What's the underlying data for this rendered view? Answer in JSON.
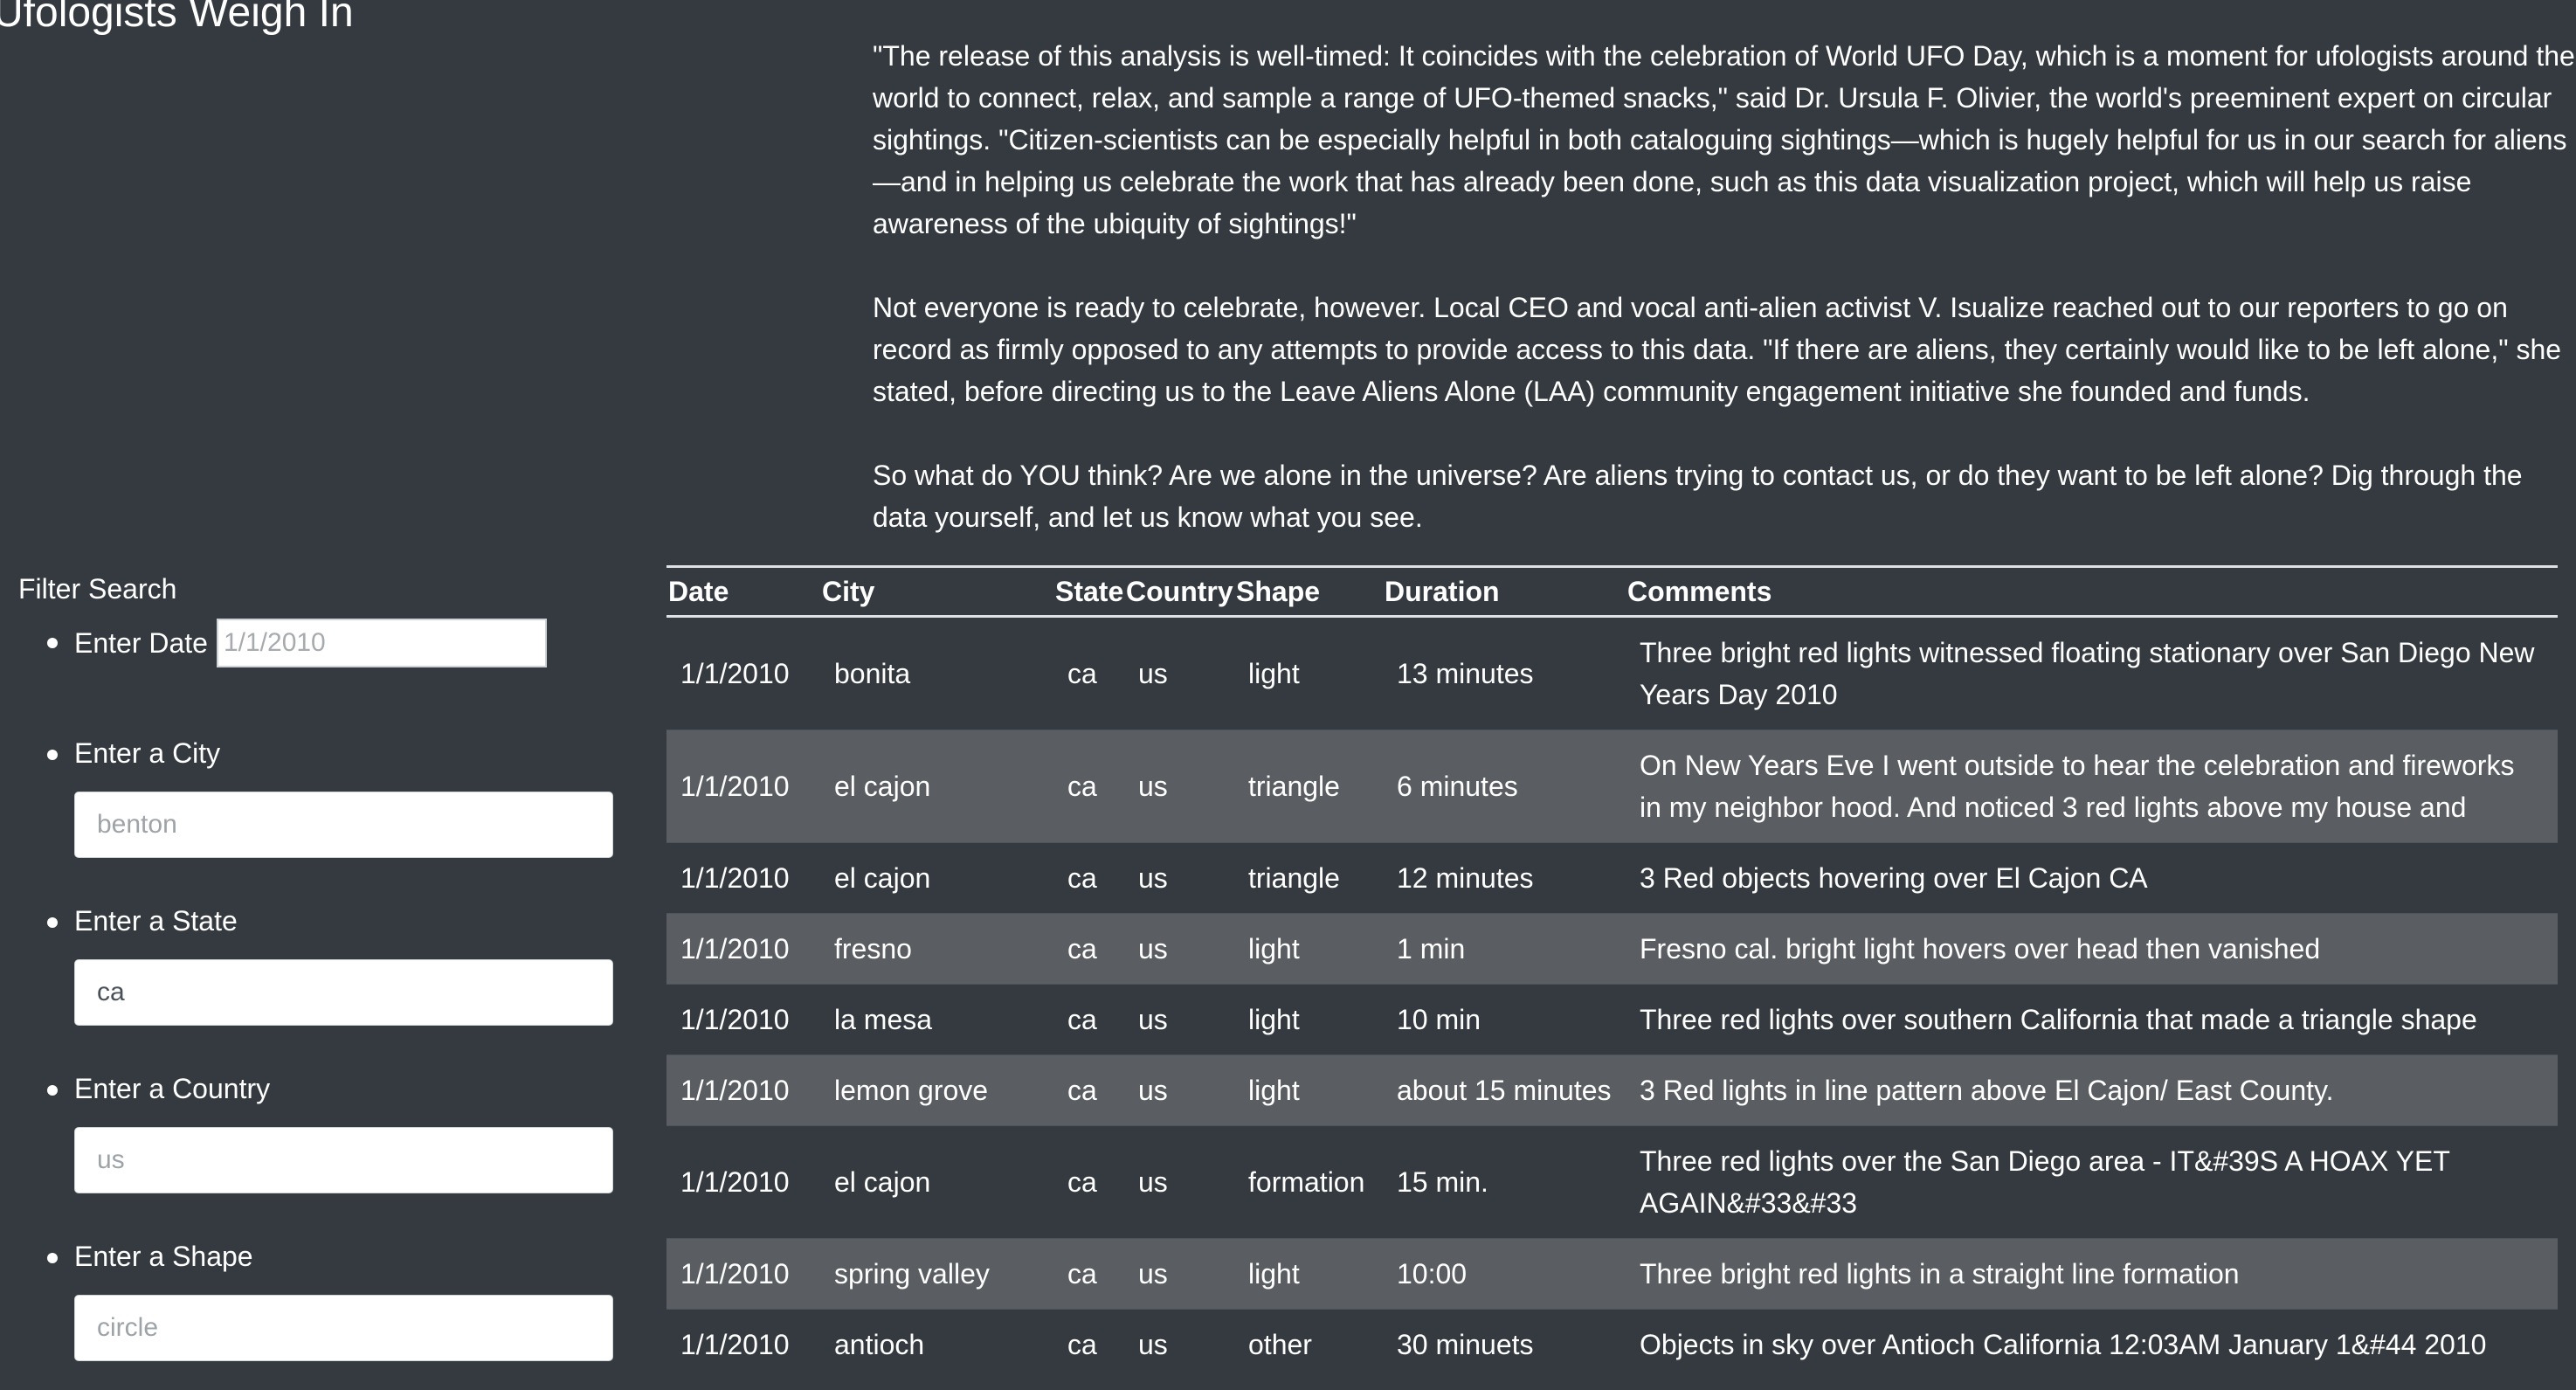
{
  "section_title": "Ufologists Weigh In",
  "article": {
    "paragraphs": [
      "\"The release of this analysis is well-timed: It coincides with the celebration of World UFO Day, which is a moment for ufologists around the world to connect, relax, and sample a range of UFO-themed snacks,\" said Dr. Ursula F. Olivier, the world's preeminent expert on circular sightings. \"Citizen-scientists can be especially helpful in both cataloguing sightings—which is hugely helpful for us in our search for aliens—and in helping us celebrate the work that has already been done, such as this data visualization project, which will help us raise awareness of the ubiquity of sightings!\"",
      "Not everyone is ready to celebrate, however. Local CEO and vocal anti-alien activist V. Isualize reached out to our reporters to go on record as firmly opposed to any attempts to provide access to this data. \"If there are aliens, they certainly would like to be left alone,\" she stated, before directing us to the Leave Aliens Alone (LAA) community engagement initiative she founded and funds.",
      "So what do YOU think? Are we alone in the universe? Are aliens trying to contact us, or do they want to be left alone? Dig through the data yourself, and let us know what you see."
    ]
  },
  "filters": {
    "title": "Filter Search",
    "date": {
      "label": "Enter Date",
      "placeholder": "1/1/2010",
      "value": ""
    },
    "city": {
      "label": "Enter a City",
      "placeholder": "benton",
      "value": ""
    },
    "state": {
      "label": "Enter a State",
      "placeholder": "ca",
      "value": "ca"
    },
    "country": {
      "label": "Enter a Country",
      "placeholder": "us",
      "value": ""
    },
    "shape": {
      "label": "Enter a Shape",
      "placeholder": "circle",
      "value": ""
    }
  },
  "table": {
    "headers": [
      "Date",
      "City",
      "State",
      "Country",
      "Shape",
      "Duration",
      "Comments"
    ],
    "rows": [
      [
        "1/1/2010",
        "bonita",
        "ca",
        "us",
        "light",
        "13 minutes",
        "Three bright red lights witnessed floating stationary over San Diego New Years Day 2010"
      ],
      [
        "1/1/2010",
        "el cajon",
        "ca",
        "us",
        "triangle",
        "6 minutes",
        "On New Years Eve I went outside to hear the celebration and fireworks in my neighbor hood. And noticed 3 red lights above my house and"
      ],
      [
        "1/1/2010",
        "el cajon",
        "ca",
        "us",
        "triangle",
        "12 minutes",
        "3 Red objects hovering over El Cajon CA"
      ],
      [
        "1/1/2010",
        "fresno",
        "ca",
        "us",
        "light",
        "1 min",
        "Fresno cal. bright light hovers over head then vanished"
      ],
      [
        "1/1/2010",
        "la mesa",
        "ca",
        "us",
        "light",
        "10 min",
        "Three red lights over southern California that made a triangle shape"
      ],
      [
        "1/1/2010",
        "lemon grove",
        "ca",
        "us",
        "light",
        "about 15 minutes",
        "3 Red lights in line pattern above El Cajon/ East County."
      ],
      [
        "1/1/2010",
        "el cajon",
        "ca",
        "us",
        "formation",
        "15 min.",
        "Three red lights over the San Diego area - IT&#39S A HOAX YET AGAIN&#33&#33"
      ],
      [
        "1/1/2010",
        "spring valley",
        "ca",
        "us",
        "light",
        "10:00",
        "Three bright red lights in a straight line formation"
      ],
      [
        "1/1/2010",
        "antioch",
        "ca",
        "us",
        "other",
        "30 minuets",
        "Objects in sky over Antioch California 12:03AM January 1&#44 2010"
      ]
    ]
  }
}
